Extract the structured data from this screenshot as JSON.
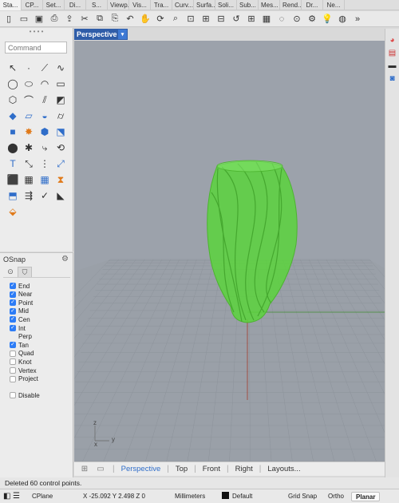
{
  "tabs": [
    "Sta...",
    "CP...",
    "Set...",
    "Di...",
    "S...",
    "Viewp...",
    "Vis...",
    "Tra...",
    "Curv...",
    "Surfa...",
    "Soli...",
    "Sub...",
    "Mes...",
    "Rend...",
    "Dr...",
    "Ne..."
  ],
  "toolbar_icons": [
    "new-file-icon",
    "open-folder-icon",
    "save-icon",
    "print-icon",
    "import-icon",
    "cut-icon",
    "copy-icon",
    "paste-icon",
    "undo-icon",
    "pan-hand-icon",
    "rotate-view-icon",
    "zoom-icon",
    "zoom-window-icon",
    "zoom-extents-icon",
    "zoom-selected-icon",
    "undo-view-icon",
    "four-view-icon",
    "grid-icon",
    "select-icon",
    "points-on-icon",
    "properties-icon",
    "bulb-icon",
    "render-icon",
    "more-icon"
  ],
  "toolbar_glyphs": [
    "▯",
    "▭",
    "▣",
    "⎙",
    "⇪",
    "✂",
    "⧉",
    "⎘",
    "↶",
    "✋",
    "⟳",
    "⌕",
    "⊡",
    "⊞",
    "⊟",
    "↺",
    "⊞",
    "▦",
    "◌",
    "⊙",
    "⚙",
    "💡",
    "◍",
    "»"
  ],
  "command": {
    "placeholder": "Command"
  },
  "tools": [
    {
      "name": "select-arrow-icon",
      "g": "↖",
      "c": ""
    },
    {
      "name": "point-icon",
      "g": "·",
      "c": ""
    },
    {
      "name": "polyline-icon",
      "g": "⟋",
      "c": ""
    },
    {
      "name": "curve-icon",
      "g": "∿",
      "c": ""
    },
    {
      "name": "circle-icon",
      "g": "◯",
      "c": ""
    },
    {
      "name": "ellipse-icon",
      "g": "⬭",
      "c": ""
    },
    {
      "name": "arc-icon",
      "g": "◠",
      "c": ""
    },
    {
      "name": "rectangle-icon",
      "g": "▭",
      "c": ""
    },
    {
      "name": "polygon-icon",
      "g": "⬡",
      "c": ""
    },
    {
      "name": "fillet-icon",
      "g": "⌒",
      "c": ""
    },
    {
      "name": "offset-icon",
      "g": "⫽",
      "c": ""
    },
    {
      "name": "blend-icon",
      "g": "◩",
      "c": ""
    },
    {
      "name": "surface-icon",
      "g": "◆",
      "c": "blue"
    },
    {
      "name": "extrude-icon",
      "g": "▱",
      "c": "blue"
    },
    {
      "name": "loft-icon",
      "g": "◒",
      "c": "blue"
    },
    {
      "name": "cylinder-icon",
      "g": "⌭",
      "c": ""
    },
    {
      "name": "box-icon",
      "g": "■",
      "c": "blue"
    },
    {
      "name": "boolean-icon",
      "g": "✸",
      "c": "orange"
    },
    {
      "name": "revolve-icon",
      "g": "⬢",
      "c": "blue"
    },
    {
      "name": "sweep-icon",
      "g": "⬔",
      "c": "blue"
    },
    {
      "name": "group-icon",
      "g": "⬤",
      "c": ""
    },
    {
      "name": "explode-icon",
      "g": "✱",
      "c": ""
    },
    {
      "name": "trim-icon",
      "g": "⤷",
      "c": ""
    },
    {
      "name": "join-icon",
      "g": "⟲",
      "c": ""
    },
    {
      "name": "text-icon",
      "g": "T",
      "c": "blue"
    },
    {
      "name": "move-icon",
      "g": "⤡",
      "c": ""
    },
    {
      "name": "array-icon",
      "g": "⋮",
      "c": ""
    },
    {
      "name": "mirror-icon",
      "g": "⤢",
      "c": "blue"
    },
    {
      "name": "mesh-icon",
      "g": "⬛",
      "c": "blue"
    },
    {
      "name": "layout-icon",
      "g": "▦",
      "c": ""
    },
    {
      "name": "grid-array-icon",
      "g": "▦",
      "c": "blue"
    },
    {
      "name": "twist-icon",
      "g": "⧗",
      "c": "orange"
    },
    {
      "name": "cage-icon",
      "g": "⬒",
      "c": "blue"
    },
    {
      "name": "analyze-icon",
      "g": "⇶",
      "c": ""
    },
    {
      "name": "check-icon",
      "g": "✓",
      "c": ""
    },
    {
      "name": "solid-icon",
      "g": "◣",
      "c": ""
    },
    {
      "name": "paint-icon",
      "g": "⬙",
      "c": "orange"
    }
  ],
  "osnap": {
    "title": "OSnap",
    "snaps": [
      {
        "label": "End",
        "checked": true
      },
      {
        "label": "Near",
        "checked": true
      },
      {
        "label": "Point",
        "checked": true
      },
      {
        "label": "Mid",
        "checked": true
      },
      {
        "label": "Cen",
        "checked": true
      },
      {
        "label": "Int",
        "checked": true
      },
      {
        "label": "Perp",
        "checked": false,
        "nobox": true
      },
      {
        "label": "Tan",
        "checked": true
      },
      {
        "label": "Quad",
        "checked": false
      },
      {
        "label": "Knot",
        "checked": false
      },
      {
        "label": "Vertex",
        "checked": false
      },
      {
        "label": "Project",
        "checked": false
      }
    ],
    "disable": {
      "label": "Disable",
      "checked": false
    }
  },
  "viewport": {
    "title": "Perspective",
    "background": "#9ca2ab",
    "object_color": "#53cc37",
    "axis_labels": {
      "z": "z",
      "y": "y",
      "x": "x"
    }
  },
  "viewport_tabs": [
    "Perspective",
    "Top",
    "Front",
    "Right",
    "Layouts..."
  ],
  "status": {
    "message": "Deleted 60 control points.",
    "cplane": "CPlane",
    "coords": "X -25.092 Y 2.498 Z 0",
    "units": "Millimeters",
    "layer": "Default",
    "grid_snap": "Grid Snap",
    "ortho": "Ortho",
    "planar": "Planar"
  }
}
